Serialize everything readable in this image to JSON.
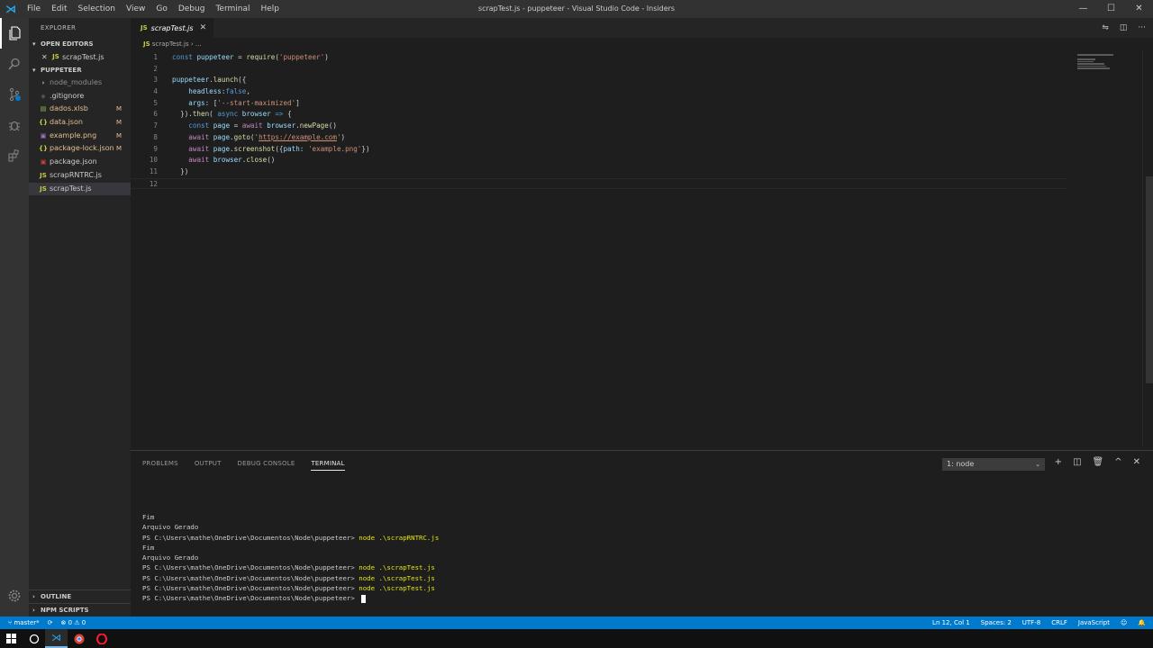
{
  "window": {
    "title": "scrapTest.js - puppeteer - Visual Studio Code - Insiders",
    "menu": [
      "File",
      "Edit",
      "Selection",
      "View",
      "Go",
      "Debug",
      "Terminal",
      "Help"
    ],
    "controls": {
      "minimize": "—",
      "maximize": "☐",
      "close": "✕"
    }
  },
  "activity_bar": {
    "icons": [
      "files-icon",
      "search-icon",
      "source-control-icon",
      "debug-icon",
      "extensions-icon"
    ],
    "bottom_icon": "gear-icon"
  },
  "sidebar": {
    "header": "EXPLORER",
    "open_editors": {
      "label": "OPEN EDITORS",
      "files": [
        {
          "name": "scrapTest.js",
          "close": "✕",
          "icon": "JS"
        }
      ]
    },
    "folder": {
      "label": "PUPPETEER",
      "items": [
        {
          "name": "node_modules",
          "icon": "›",
          "icon_color": "#cccccc",
          "text_color": "#8c8c8c",
          "badge": ""
        },
        {
          "name": ".gitignore",
          "icon": "◆",
          "icon_color": "#41535b",
          "text_color": "#cccccc",
          "badge": ""
        },
        {
          "name": "dados.xlsb",
          "icon": "▤",
          "icon_color": "#8dc149",
          "text_color": "#e2c08d",
          "badge": "M"
        },
        {
          "name": "data.json",
          "icon": "{}",
          "icon_color": "#cbcb41",
          "text_color": "#e2c08d",
          "badge": "M"
        },
        {
          "name": "example.png",
          "icon": "▣",
          "icon_color": "#a074c4",
          "text_color": "#e2c08d",
          "badge": "M"
        },
        {
          "name": "package-lock.json",
          "icon": "{}",
          "icon_color": "#cbcb41",
          "text_color": "#e2c08d",
          "badge": "M"
        },
        {
          "name": "package.json",
          "icon": "▣",
          "icon_color": "#cc3e44",
          "text_color": "#cccccc",
          "badge": ""
        },
        {
          "name": "scrapRNTRC.js",
          "icon": "JS",
          "icon_color": "#cbcb41",
          "text_color": "#cccccc",
          "badge": ""
        },
        {
          "name": "scrapTest.js",
          "icon": "JS",
          "icon_color": "#cbcb41",
          "text_color": "#cccccc",
          "badge": "",
          "selected": true
        }
      ]
    },
    "outline_label": "OUTLINE",
    "npm_scripts_label": "NPM SCRIPTS"
  },
  "editor": {
    "tab": {
      "icon": "JS",
      "label": "scrapTest.js",
      "close": "✕"
    },
    "breadcrumb": {
      "icon": "JS",
      "file": "scrapTest.js",
      "sep": " › ..."
    },
    "lines": [
      {
        "n": "1",
        "tokens": [
          [
            "kw",
            "const "
          ],
          [
            "va",
            "puppeteer"
          ],
          [
            "pa",
            " = "
          ],
          [
            "fn",
            "require"
          ],
          [
            "pa",
            "("
          ],
          [
            "st",
            "'puppeteer'"
          ],
          [
            "pa",
            ")"
          ]
        ]
      },
      {
        "n": "2",
        "tokens": []
      },
      {
        "n": "3",
        "tokens": [
          [
            "va",
            "puppeteer"
          ],
          [
            "pa",
            "."
          ],
          [
            "fn",
            "launch"
          ],
          [
            "pa",
            "({"
          ]
        ]
      },
      {
        "n": "4",
        "tokens": [
          [
            "pa",
            "    "
          ],
          [
            "va",
            "headless"
          ],
          [
            "pa",
            ":"
          ],
          [
            "kw",
            "false"
          ],
          [
            "pa",
            ","
          ]
        ]
      },
      {
        "n": "5",
        "tokens": [
          [
            "pa",
            "    "
          ],
          [
            "va",
            "args"
          ],
          [
            "pa",
            ": ["
          ],
          [
            "st",
            "'--start-maximized'"
          ],
          [
            "pa",
            "]"
          ]
        ]
      },
      {
        "n": "6",
        "tokens": [
          [
            "pa",
            "  })."
          ],
          [
            "fn",
            "then"
          ],
          [
            "pa",
            "( "
          ],
          [
            "kw",
            "async "
          ],
          [
            "va",
            "browser"
          ],
          [
            "pa",
            " "
          ],
          [
            "kw",
            "=>"
          ],
          [
            "pa",
            " {"
          ]
        ]
      },
      {
        "n": "7",
        "tokens": [
          [
            "pa",
            "    "
          ],
          [
            "kw",
            "const "
          ],
          [
            "va",
            "page"
          ],
          [
            "pa",
            " = "
          ],
          [
            "kw2",
            "await "
          ],
          [
            "va",
            "browser"
          ],
          [
            "pa",
            "."
          ],
          [
            "fn",
            "newPage"
          ],
          [
            "pa",
            "()"
          ]
        ]
      },
      {
        "n": "8",
        "tokens": [
          [
            "pa",
            "    "
          ],
          [
            "kw2",
            "await "
          ],
          [
            "va",
            "page"
          ],
          [
            "pa",
            "."
          ],
          [
            "fn",
            "goto"
          ],
          [
            "pa",
            "("
          ],
          [
            "st",
            "'"
          ],
          [
            "ur",
            "https://example.com"
          ],
          [
            "st",
            "'"
          ],
          [
            "pa",
            ")"
          ]
        ]
      },
      {
        "n": "9",
        "tokens": [
          [
            "pa",
            "    "
          ],
          [
            "kw2",
            "await "
          ],
          [
            "va",
            "page"
          ],
          [
            "pa",
            "."
          ],
          [
            "fn",
            "screenshot"
          ],
          [
            "pa",
            "({"
          ],
          [
            "va",
            "path"
          ],
          [
            "pa",
            ": "
          ],
          [
            "st",
            "'example.png'"
          ],
          [
            "pa",
            "})"
          ]
        ]
      },
      {
        "n": "10",
        "tokens": [
          [
            "pa",
            "    "
          ],
          [
            "kw2",
            "await "
          ],
          [
            "va",
            "browser"
          ],
          [
            "pa",
            "."
          ],
          [
            "fn",
            "close"
          ],
          [
            "pa",
            "()"
          ]
        ]
      },
      {
        "n": "11",
        "tokens": [
          [
            "pa",
            "  })"
          ]
        ]
      },
      {
        "n": "12",
        "tokens": []
      }
    ]
  },
  "panel": {
    "tabs": [
      "PROBLEMS",
      "OUTPUT",
      "DEBUG CONSOLE",
      "TERMINAL"
    ],
    "active_tab": "TERMINAL",
    "terminal_select": "1: node",
    "actions": [
      "+",
      "◫",
      "🗑",
      "^",
      "✕"
    ],
    "terminal_lines": [
      {
        "prompt": "Fim",
        "cmd": ""
      },
      {
        "prompt": "Arquivo Gerado",
        "cmd": ""
      },
      {
        "prompt": "PS C:\\Users\\mathe\\OneDrive\\Documentos\\Node\\puppeteer> ",
        "cmd": "node .\\scrapRNTRC.js"
      },
      {
        "prompt": "Fim",
        "cmd": ""
      },
      {
        "prompt": "Arquivo Gerado",
        "cmd": ""
      },
      {
        "prompt": "PS C:\\Users\\mathe\\OneDrive\\Documentos\\Node\\puppeteer> ",
        "cmd": "node .\\scrapTest.js"
      },
      {
        "prompt": "PS C:\\Users\\mathe\\OneDrive\\Documentos\\Node\\puppeteer> ",
        "cmd": "node .\\scrapTest.js"
      },
      {
        "prompt": "PS C:\\Users\\mathe\\OneDrive\\Documentos\\Node\\puppeteer> ",
        "cmd": "node .\\scrapTest.js"
      },
      {
        "prompt": "PS C:\\Users\\mathe\\OneDrive\\Documentos\\Node\\puppeteer> ",
        "cmd": "",
        "cursor": true
      }
    ]
  },
  "status_bar": {
    "branch": "master*",
    "sync": "⟳",
    "problems": "⊗ 0 ⚠ 0",
    "position": "Ln 12, Col 1",
    "spaces": "Spaces: 2",
    "encoding": "UTF-8",
    "eol": "CRLF",
    "language": "JavaScript",
    "feedback": "☺",
    "bell": "🔔"
  },
  "taskbar": {
    "icons": [
      "windows-start-icon",
      "search-circle-icon",
      "vscode-icon",
      "chrome-icon",
      "opera-icon"
    ]
  },
  "colors": {
    "accent": "#007acc",
    "modified": "#e2c08d"
  }
}
